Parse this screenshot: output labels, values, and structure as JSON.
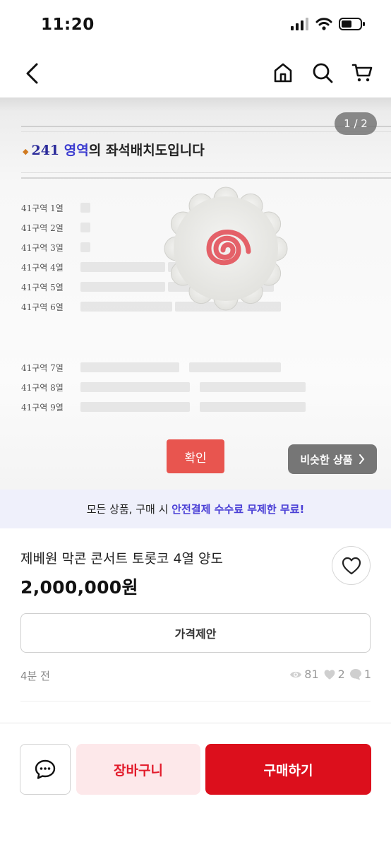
{
  "status_bar": {
    "time": "11:20"
  },
  "header": {
    "back_icon": "chevron-left-icon",
    "icons": [
      "home-icon",
      "search-icon",
      "cart-icon"
    ]
  },
  "image": {
    "page_indicator": "1 / 2",
    "seat_title_num": "241",
    "seat_title_zone": "영역",
    "seat_title_rest": "의 좌석배치도입니다",
    "rows": [
      "41구역 1열",
      "41구역 2열",
      "41구역 3열",
      "41구역 4열",
      "41구역 5열",
      "41구역 6열",
      "41구역 7열",
      "41구역 8열",
      "41구역 9열"
    ],
    "confirm_label": "확인",
    "similar_label": "비슷한 상품"
  },
  "promo": {
    "prefix": "모든 상품, 구매 시 ",
    "highlight": "안전결제 수수료 무제한 무료!"
  },
  "product": {
    "title": "제베원 막콘 콘서트 토롯코 4열 양도",
    "price": "2,000,000원",
    "offer_label": "가격제안",
    "posted": "4분 전",
    "views": "81",
    "likes": "2",
    "chats": "1"
  },
  "bottom": {
    "cart_label": "장바구니",
    "buy_label": "구매하기"
  },
  "colors": {
    "brand_red": "#dc0f1c",
    "cart_bg": "#fde8ea",
    "promo_highlight": "#4a3fd6",
    "promo_bg": "#eff0fb"
  }
}
